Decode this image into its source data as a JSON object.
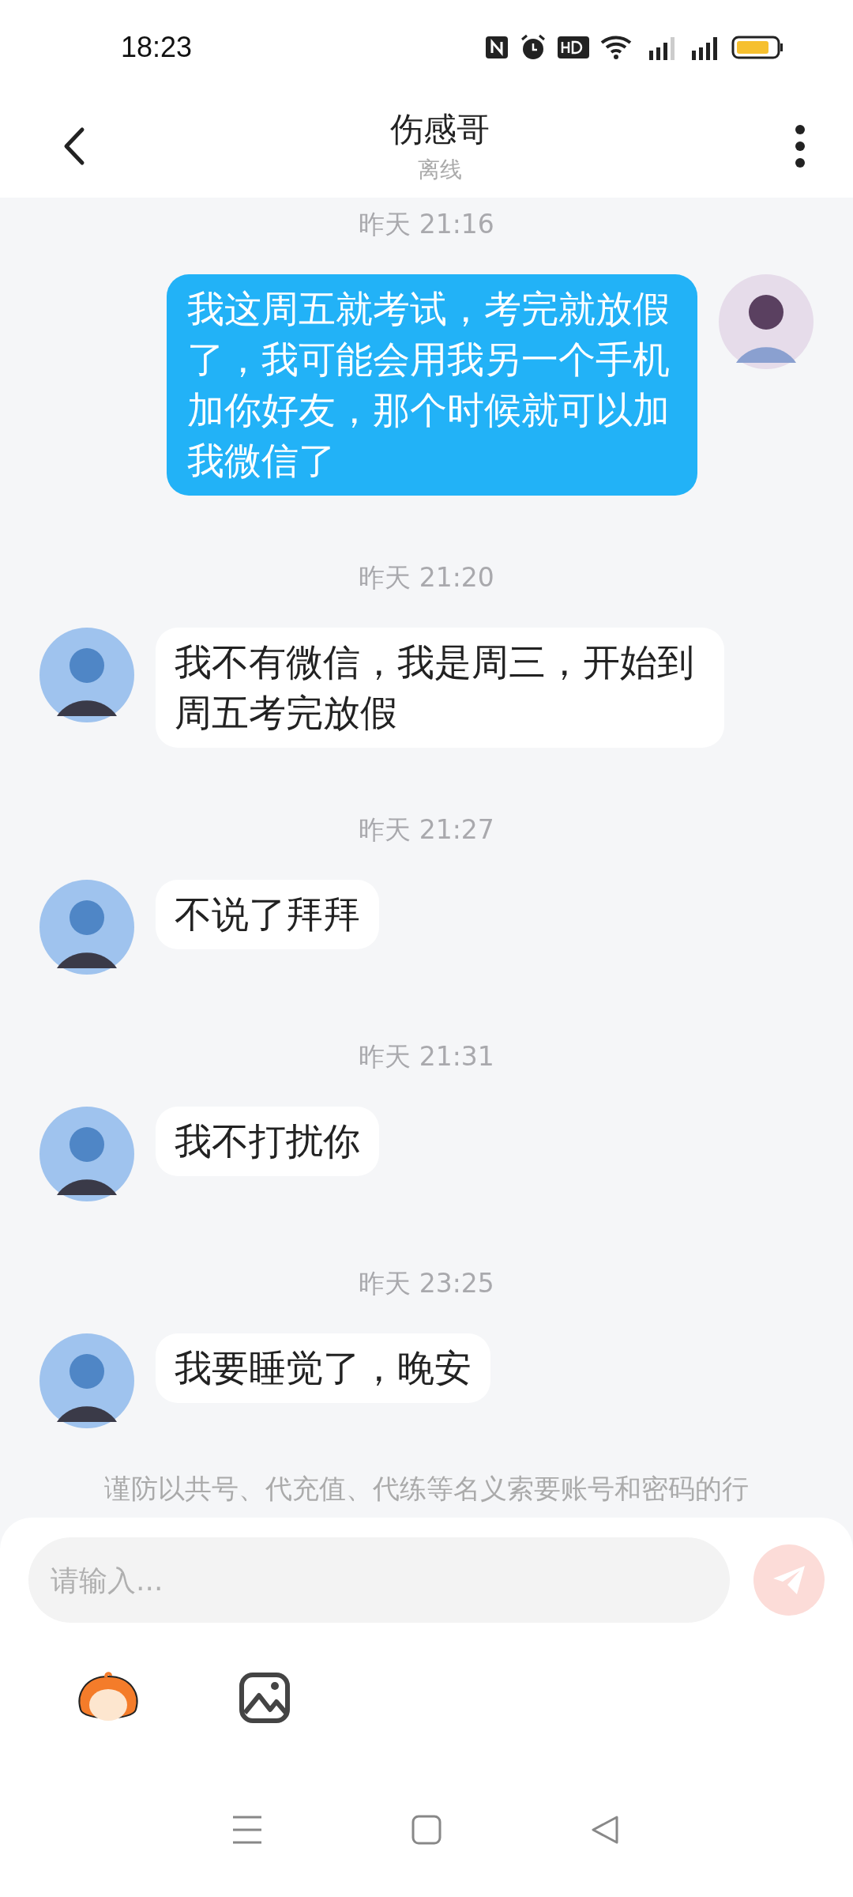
{
  "status_bar": {
    "time": "18:23"
  },
  "header": {
    "title": "伤感哥",
    "subtitle": "离线"
  },
  "messages": [
    {
      "time": "昨天 21:16",
      "kind": "sent",
      "text": "我这周五就考试，考完就放假了，我可能会用我另一个手机加你好友，那个时候就可以加我微信了"
    },
    {
      "time": "昨天 21:20",
      "kind": "received",
      "text": "我不有微信，我是周三，开始到周五考完放假"
    },
    {
      "time": "昨天 21:27",
      "kind": "received",
      "text": "不说了拜拜"
    },
    {
      "time": "昨天 21:31",
      "kind": "received",
      "text": "我不打扰你"
    },
    {
      "time": "昨天 23:25",
      "kind": "received",
      "text": "我要睡觉了，晚安"
    }
  ],
  "notice": "谨防以共号、代充值、代练等名义索要账号和密码的行",
  "composer": {
    "placeholder": "请输入..."
  }
}
